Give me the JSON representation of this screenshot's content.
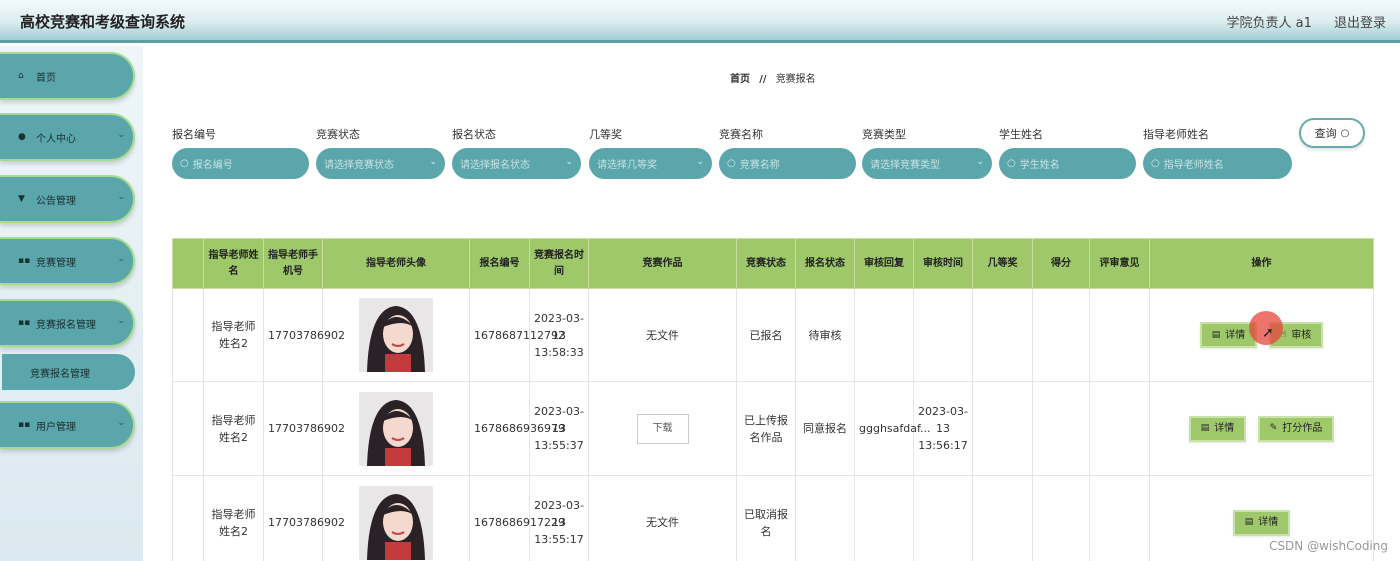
{
  "header": {
    "title": "高校竞赛和考级查询系统",
    "user_label": "学院负责人 a1",
    "logout_label": "退出登录"
  },
  "sidebar": {
    "items": [
      {
        "label": "首页",
        "icon": "home-icon"
      },
      {
        "label": "个人中心",
        "icon": "user-icon"
      },
      {
        "label": "公告管理",
        "icon": "notice-icon"
      },
      {
        "label": "竞赛管理",
        "icon": "grid-icon"
      },
      {
        "label": "竞赛报名管理",
        "icon": "grid-icon"
      },
      {
        "label": "用户管理",
        "icon": "grid-icon"
      }
    ],
    "submenu_label": "竞赛报名管理"
  },
  "breadcrumb": {
    "home": "首页",
    "separator": "//",
    "current": "竞赛报名"
  },
  "search": {
    "fields": [
      {
        "label": "报名编号",
        "placeholder": "报名编号"
      },
      {
        "label": "竞赛状态",
        "placeholder": "请选择竞赛状态"
      },
      {
        "label": "报名状态",
        "placeholder": "请选择报名状态"
      },
      {
        "label": "几等奖",
        "placeholder": "请选择几等奖"
      },
      {
        "label": "竞赛名称",
        "placeholder": "竞赛名称"
      },
      {
        "label": "竞赛类型",
        "placeholder": "请选择竞赛类型"
      },
      {
        "label": "学生姓名",
        "placeholder": "学生姓名"
      },
      {
        "label": "指导老师姓名",
        "placeholder": "指导老师姓名"
      }
    ],
    "query_label": "查询"
  },
  "table": {
    "headers": {
      "teacher_name": "指导老师姓名",
      "teacher_phone": "指导老师手机号",
      "teacher_avatar": "指导老师头像",
      "enroll_no": "报名编号",
      "enroll_time": "竞赛报名时间",
      "work": "竞赛作品",
      "comp_status": "竞赛状态",
      "enroll_status": "报名状态",
      "review_reply": "审核回复",
      "review_time": "审核时间",
      "prize": "几等奖",
      "score": "得分",
      "review_opinion": "评审意见",
      "actions": "操作"
    },
    "rows": [
      {
        "teacher_name": "指导老师姓名2",
        "teacher_phone": "17703786902",
        "enroll_no": "1678687112792",
        "enroll_time": "2023-03-13 13:58:33",
        "work": "无文件",
        "comp_status": "已报名",
        "enroll_status": "待审核",
        "review_reply": "",
        "review_time": "",
        "prize": "",
        "score": "",
        "review_opinion": "",
        "actions": [
          "详情",
          "审核"
        ]
      },
      {
        "teacher_name": "指导老师姓名2",
        "teacher_phone": "17703786902",
        "enroll_no": "1678686936979",
        "enroll_time": "2023-03-13 13:55:37",
        "work_button": "下载",
        "comp_status": "已上传报名作品",
        "enroll_status": "同意报名",
        "review_reply": "ggghsafdaf...",
        "review_time": "2023-03-13 13:56:17",
        "prize": "",
        "score": "",
        "review_opinion": "",
        "actions": [
          "详情",
          "打分作品"
        ]
      },
      {
        "teacher_name": "指导老师姓名2",
        "teacher_phone": "17703786902",
        "enroll_no": "1678686917229",
        "enroll_time": "2023-03-13 13:55:17",
        "work": "无文件",
        "comp_status": "已取消报名",
        "enroll_status": "",
        "review_reply": "",
        "review_time": "",
        "prize": "",
        "score": "",
        "review_opinion": "",
        "actions": [
          "详情"
        ]
      }
    ]
  },
  "watermark": "CSDN @wishCoding",
  "colors": {
    "accent": "#5aa6ab",
    "table_header": "#9ec86a",
    "button": "#9ec86a"
  }
}
